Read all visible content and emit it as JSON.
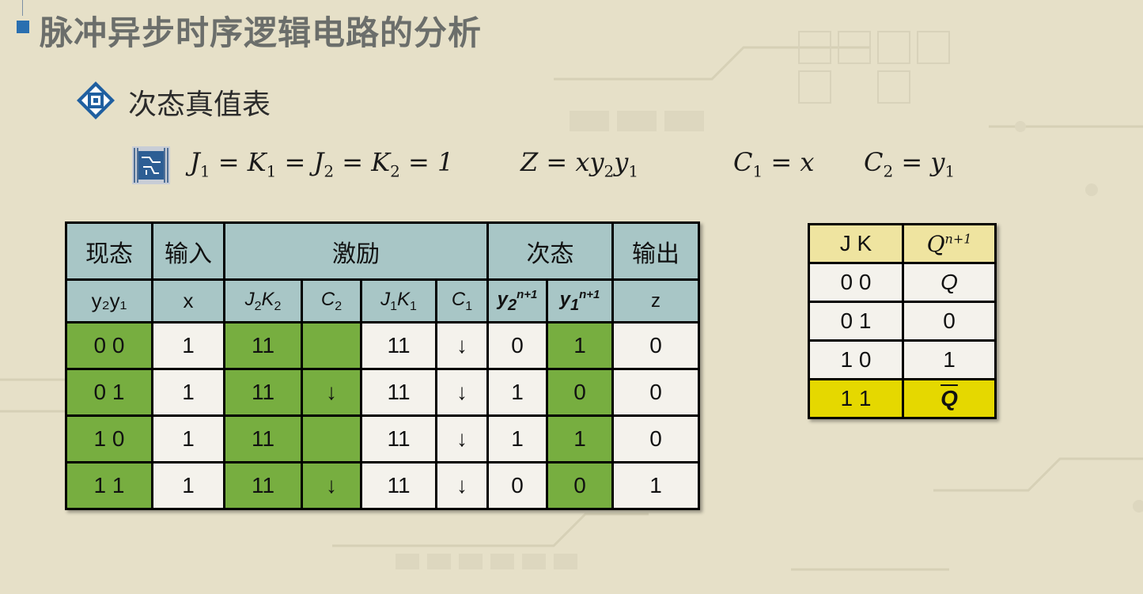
{
  "title": "脉冲异步时序逻辑电路的分析",
  "subtitle": "次态真值表",
  "formulas": {
    "f1": {
      "a": "J",
      "a_sub": "1",
      "b": " = K",
      "b_sub": "1",
      "c": " = J",
      "c_sub": "2",
      "d": " = K",
      "d_sub": "2",
      "e": " = 1"
    },
    "f2": {
      "a": "Z = xy",
      "a_sub": "2",
      "b": "y",
      "b_sub": "1"
    },
    "f3": {
      "a": "C",
      "a_sub": "1",
      "b": " = x"
    },
    "f4": {
      "a": "C",
      "a_sub": "2",
      "b": " = y",
      "b_sub": "1"
    }
  },
  "main_table": {
    "group_headers": [
      "现态",
      "输入",
      "激励",
      "次态",
      "输出"
    ],
    "col_headers": {
      "state": "y₂y₁",
      "input": "x",
      "j2k2_j": "J",
      "j2k2_j_sub": "2",
      "j2k2_k": "K",
      "j2k2_k_sub": "2",
      "c2": "C",
      "c2_sub": "2",
      "j1k1_j": "J",
      "j1k1_j_sub": "1",
      "j1k1_k": "K",
      "j1k1_k_sub": "1",
      "c1": "C",
      "c1_sub": "1",
      "y2n": "y",
      "y2n_sub": "2",
      "y2n_sup": "n+1",
      "y1n": "y",
      "y1n_sub": "1",
      "y1n_sup": "n+1",
      "out": "z"
    },
    "rows": [
      {
        "state": "0  0",
        "x": "1",
        "j2k2": "11",
        "c2": "",
        "j1k1": "11",
        "c1": "↓",
        "y2n": "0",
        "y1n": "1",
        "z": "0"
      },
      {
        "state": "0  1",
        "x": "1",
        "j2k2": "11",
        "c2": "↓",
        "j1k1": "11",
        "c1": "↓",
        "y2n": "1",
        "y1n": "0",
        "z": "0"
      },
      {
        "state": "1  0",
        "x": "1",
        "j2k2": "11",
        "c2": "",
        "j1k1": "11",
        "c1": "↓",
        "y2n": "1",
        "y1n": "1",
        "z": "0"
      },
      {
        "state": "1  1",
        "x": "1",
        "j2k2": "11",
        "c2": "↓",
        "j1k1": "11",
        "c1": "↓",
        "y2n": "0",
        "y1n": "0",
        "z": "1"
      }
    ]
  },
  "jk_table": {
    "header_jk": "J  K",
    "header_q": "Q",
    "header_q_sup": "n+1",
    "rows": [
      {
        "jk": "0 0",
        "q": "Q"
      },
      {
        "jk": "0 1",
        "q": "0"
      },
      {
        "jk": "1 0",
        "q": "1"
      },
      {
        "jk": "1 1",
        "q": "Q"
      }
    ]
  },
  "colors": {
    "background": "#e6e0c8",
    "header": "#a8c6c6",
    "green": "#77ae40",
    "highlight_yellow": "#e5d800",
    "jk_header": "#efe4a0",
    "accent_blue": "#2a6fb0"
  },
  "icons": [
    "title-square-icon",
    "chip-diamond-icon",
    "circuit-chip-icon"
  ]
}
